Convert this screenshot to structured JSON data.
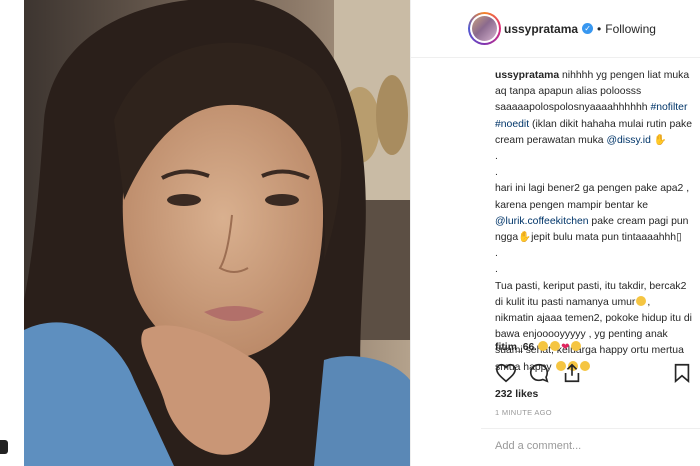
{
  "post": {
    "username": "ussypratama",
    "follow_status": "Following",
    "separator": "•",
    "caption_lines": [
      "nihhhh yg pengen liat muka",
      "aq tanpa apapun alias poloosss",
      "saaaaapolospolosnyaaaahhhhhh",
      "(iklan dikit hahaha mulai rutin pake",
      "cream perawatan muka",
      ".",
      ".",
      "hari ini lagi bener2 ga pengen pake apa2 ,",
      "karena pengen mampir bentar ke",
      "pake cream pagi pun",
      "ngga",
      "jepit bulu mata pun tintaaaahhh",
      ".",
      ".",
      "Tua pasti, keriput pasti, itu takdir, bercak2",
      "di kulit itu pasti namanya umur",
      "nikmatin ajaaa temen2, pokoke hidup itu di",
      "bawa enjooooyyyyy , yg penting anak",
      "suami sehat, keluarga happy ortu mertua",
      "smua happy"
    ],
    "hashtags": [
      "#nofilter",
      "#noedit"
    ],
    "mentions": [
      "@dissy.id",
      "@lurik.coffeekitchen"
    ],
    "comment": {
      "username": "fitim_66"
    },
    "likes": "232 likes",
    "timestamp": "1 MINUTE AGO",
    "comment_placeholder": "Add a comment..."
  },
  "colors": {
    "link": "#003569",
    "verified": "#3897f0",
    "muted": "#999999",
    "heart": "#e0245e"
  },
  "icons": [
    "verified-icon",
    "heart-icon",
    "comment-icon",
    "share-icon",
    "bookmark-icon"
  ]
}
